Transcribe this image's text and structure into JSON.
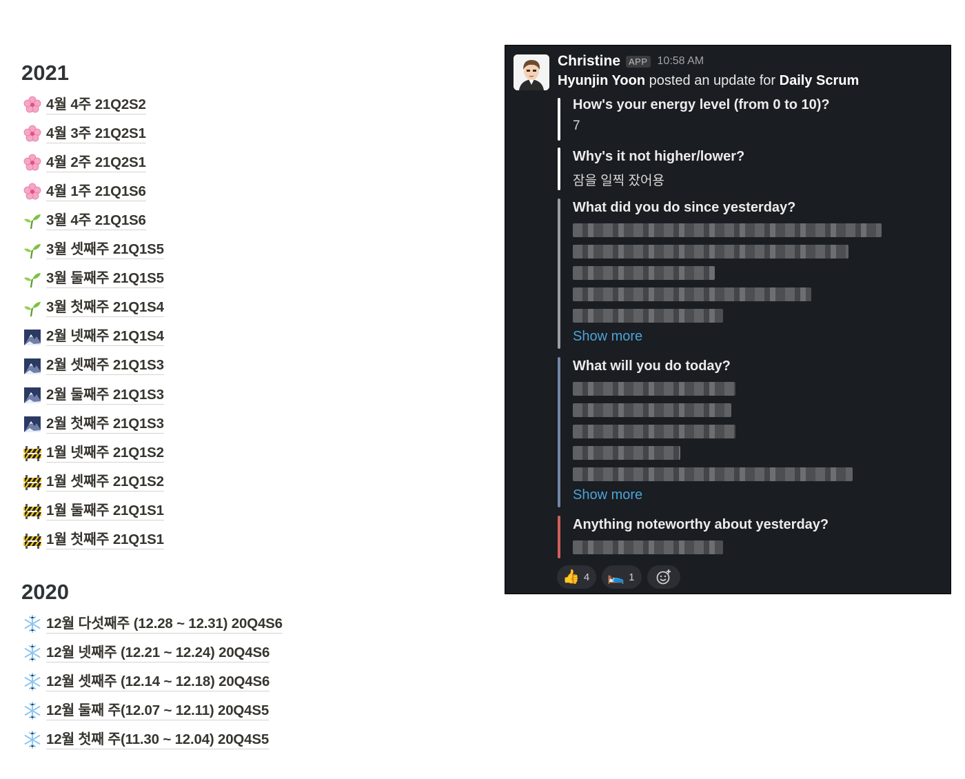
{
  "notion": {
    "sections": [
      {
        "year": "2021",
        "items": [
          {
            "icon": "cherry-blossom-icon",
            "label": "4월 4주 21Q2S2"
          },
          {
            "icon": "cherry-blossom-icon",
            "label": "4월 3주 21Q2S1"
          },
          {
            "icon": "cherry-blossom-icon",
            "label": "4월 2주 21Q2S1"
          },
          {
            "icon": "cherry-blossom-icon",
            "label": "4월 1주 21Q1S6"
          },
          {
            "icon": "seedling-icon",
            "label": "3월 4주 21Q1S6"
          },
          {
            "icon": "seedling-icon",
            "label": "3월 셋째주 21Q1S5"
          },
          {
            "icon": "seedling-icon",
            "label": "3월 둘째주 21Q1S5"
          },
          {
            "icon": "seedling-icon",
            "label": "3월 첫째주 21Q1S4"
          },
          {
            "icon": "snow-mountain-icon",
            "label": "2월 넷째주 21Q1S4"
          },
          {
            "icon": "snow-mountain-icon",
            "label": "2월 셋째주 21Q1S3"
          },
          {
            "icon": "snow-mountain-icon",
            "label": "2월 둘째주 21Q1S3"
          },
          {
            "icon": "snow-mountain-icon",
            "label": "2월 첫째주 21Q1S3"
          },
          {
            "icon": "construction-icon",
            "label": "1월 넷째주 21Q1S2"
          },
          {
            "icon": "construction-icon",
            "label": "1월 셋째주 21Q1S2"
          },
          {
            "icon": "construction-icon",
            "label": "1월 둘째주 21Q1S1"
          },
          {
            "icon": "construction-icon",
            "label": "1월 첫째주 21Q1S1"
          }
        ]
      },
      {
        "year": "2020",
        "items": [
          {
            "icon": "snowflake-icon",
            "label": "12월 다섯째주 (12.28 ~ 12.31) 20Q4S6"
          },
          {
            "icon": "snowflake-icon",
            "label": "12월 넷째주 (12.21 ~ 12.24) 20Q4S6"
          },
          {
            "icon": "snowflake-icon",
            "label": "12월 셋째주 (12.14 ~ 12.18) 20Q4S6"
          },
          {
            "icon": "snowflake-icon",
            "label": "12월 둘째 주(12.07 ~ 12.11) 20Q4S5"
          },
          {
            "icon": "snowflake-icon",
            "label": "12월 첫째 주(11.30 ~ 12.04) 20Q4S5"
          }
        ]
      }
    ]
  },
  "slack": {
    "sender": "Christine",
    "app_badge": "APP",
    "time": "10:58 AM",
    "poster": "Hyunjin Yoon",
    "posted_text": " posted an update for ",
    "standup": "Daily Scrum",
    "colors": {
      "white": "#ffffff",
      "gray": "#9aa0a6",
      "blue": "#7585a8",
      "red": "#d1605e",
      "link": "#4da3d9"
    },
    "questions": [
      {
        "question": "How's your energy level (from 0 to 10)?",
        "answer": "7"
      },
      {
        "question": "Why's it not higher/lower?",
        "answer": "잠을 일찍 잤어용"
      },
      {
        "question": "What did you do since yesterday?",
        "answer": "",
        "show_more": "Show more"
      },
      {
        "question": "What will you do today?",
        "answer": "",
        "show_more": "Show more"
      },
      {
        "question": "Anything noteworthy about yesterday?",
        "answer": ""
      }
    ],
    "reactions": [
      {
        "emoji": "👍",
        "count": "4"
      },
      {
        "emoji": "🛌",
        "count": "1"
      }
    ]
  }
}
